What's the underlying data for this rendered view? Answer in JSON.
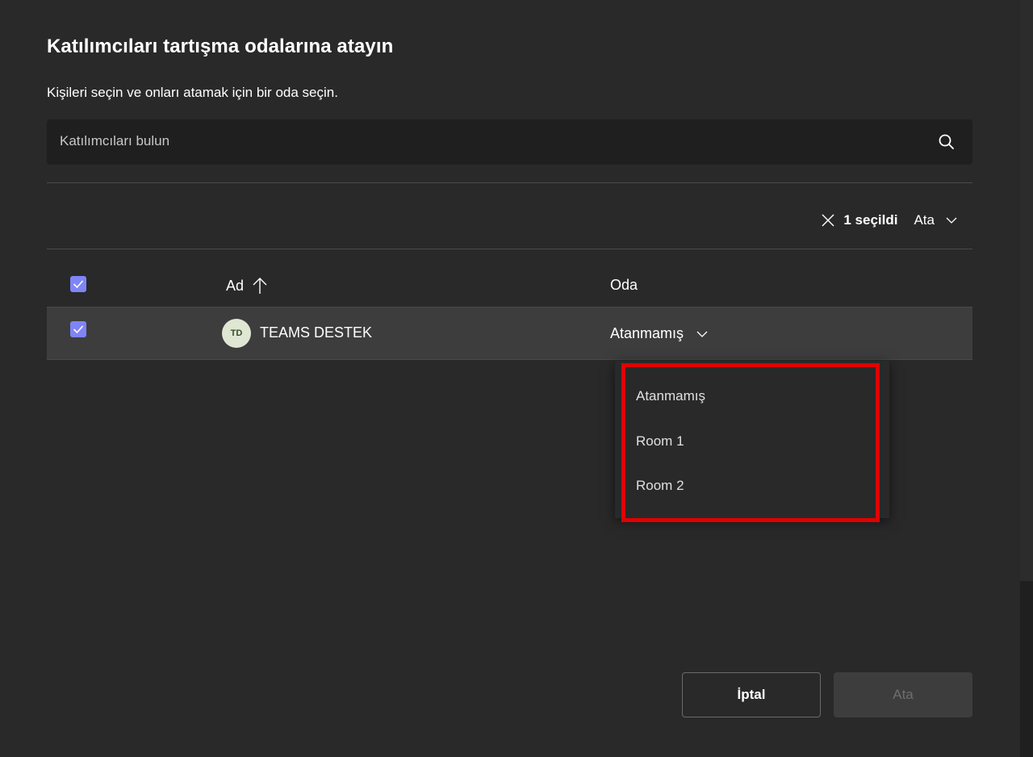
{
  "dialog": {
    "title": "Katılımcıları tartışma odalarına atayın",
    "subtitle": "Kişileri seçin ve onları atamak için bir oda seçin."
  },
  "search": {
    "placeholder": "Katılımcıları bulun",
    "icon": "search-icon"
  },
  "selection_bar": {
    "count_label": "1 seçildi",
    "assign_label": "Ata",
    "clear_icon": "close-icon",
    "chevron_icon": "chevron-down-icon"
  },
  "table": {
    "headers": {
      "name": "Ad",
      "room": "Oda"
    },
    "sort_icon": "arrow-up-icon",
    "rows": [
      {
        "initials": "TD",
        "name": "TEAMS DESTEK",
        "room": "Atanmamış",
        "selected": true
      }
    ]
  },
  "room_menu": {
    "options": [
      "Atanmamış",
      "Room 1",
      "Room 2"
    ]
  },
  "footer": {
    "cancel_label": "İptal",
    "assign_label": "Ata"
  },
  "colors": {
    "background": "#292929",
    "checkbox": "#7f85f5",
    "highlight": "#e00000",
    "row_selected": "#3d3d3d"
  }
}
